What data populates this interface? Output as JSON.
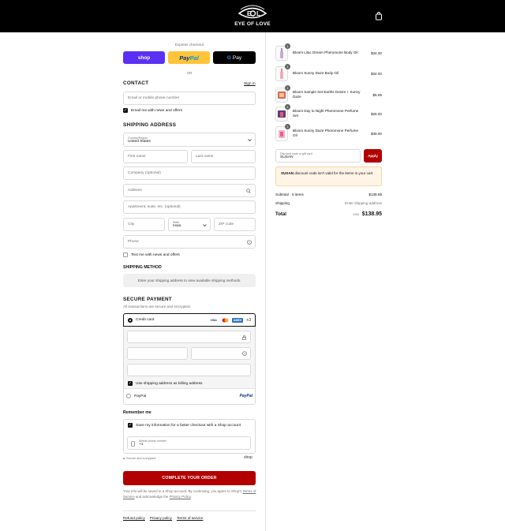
{
  "header": {
    "brand": "EYE OF LOVE"
  },
  "express": {
    "label": "Express checkout",
    "shop_label": "shop",
    "paypal_label_1": "Pay",
    "paypal_label_2": "Pal",
    "gpay_label": "Pay",
    "or_label": "OR"
  },
  "contact": {
    "title": "CONTACT",
    "signin": "Sign in",
    "email_placeholder": "Email or mobile phone number",
    "news_label": "Email me with news and offers"
  },
  "shipping": {
    "title": "SHIPPING ADDRESS",
    "country_label": "Country/Region",
    "country_value": "United States",
    "first_name": "First name",
    "last_name": "Last name",
    "company": "Company (optional)",
    "address": "Address",
    "apartment": "Apartment, suite, etc. (optional)",
    "city": "City",
    "state_label": "State",
    "state_value": "Iowa",
    "zip": "ZIP code",
    "phone": "Phone",
    "text_label": "Text me with news and offers"
  },
  "shipping_method": {
    "title": "SHIPPING METHOD",
    "message": "Enter your shipping address to view available shipping methods."
  },
  "payment": {
    "title": "SECURE PAYMENT",
    "subtitle": "All transactions are secure and encrypted.",
    "credit_card": "Credit card",
    "visa": "VISA",
    "amex": "AMEX",
    "billing_label": "Use shipping address as billing address",
    "paypal_label": "PayPal",
    "paypal_logo": "PayPal"
  },
  "remember": {
    "title": "Remember me",
    "save_label": "Save my information for a faster checkout with a Shop account",
    "mobile_label": "Mobile phone number",
    "mobile_value": "+1",
    "secure_label": "Secure and encrypted",
    "shop_logo": "shop"
  },
  "complete_button": "COMPLETE YOUR ORDER",
  "legal": {
    "text_1": "Your info will be saved to a Shop account. By continuing, you agree to Shop's",
    "terms": "Terms of Service",
    "text_2": "and acknowledge the",
    "privacy": "Privacy Policy",
    "text_3": "."
  },
  "footer": {
    "refund": "Refund policy",
    "privacy": "Privacy policy",
    "terms": "Terms of service"
  },
  "summary": {
    "items": [
      {
        "name": "Bloom Lilac Dream Pheromone Body Oil",
        "price": "$34.00",
        "qty": "1"
      },
      {
        "name": "Bloom Sunny Daze Body Oil",
        "price": "$34.00",
        "qty": "1"
      },
      {
        "name": "Bloom Sample Set Earths Desire + Sunny Daze",
        "price": "$6.95",
        "qty": "1"
      },
      {
        "name": "Bloom Day to Night Pheromone Perfume Set",
        "price": "$25.00",
        "qty": "1"
      },
      {
        "name": "Bloom Sunny Daze Pheromone Perfume Oil",
        "price": "$39.00",
        "qty": "1"
      }
    ],
    "discount_label": "Discount code or gift card",
    "discount_value": "SUSAN",
    "apply": "Apply",
    "error_code": "SUSAN",
    "error_text": "discount code isn't valid for the items in your cart",
    "subtotal_label": "Subtotal · 5 items",
    "subtotal_value": "$138.95",
    "shipping_label": "Shipping",
    "shipping_value": "Enter shipping address",
    "total_label": "Total",
    "currency": "USD",
    "total_value": "$138.95"
  },
  "colors": {
    "accent": "#b20000",
    "shop": "#5a31f4",
    "paypal": "#ffc439"
  }
}
